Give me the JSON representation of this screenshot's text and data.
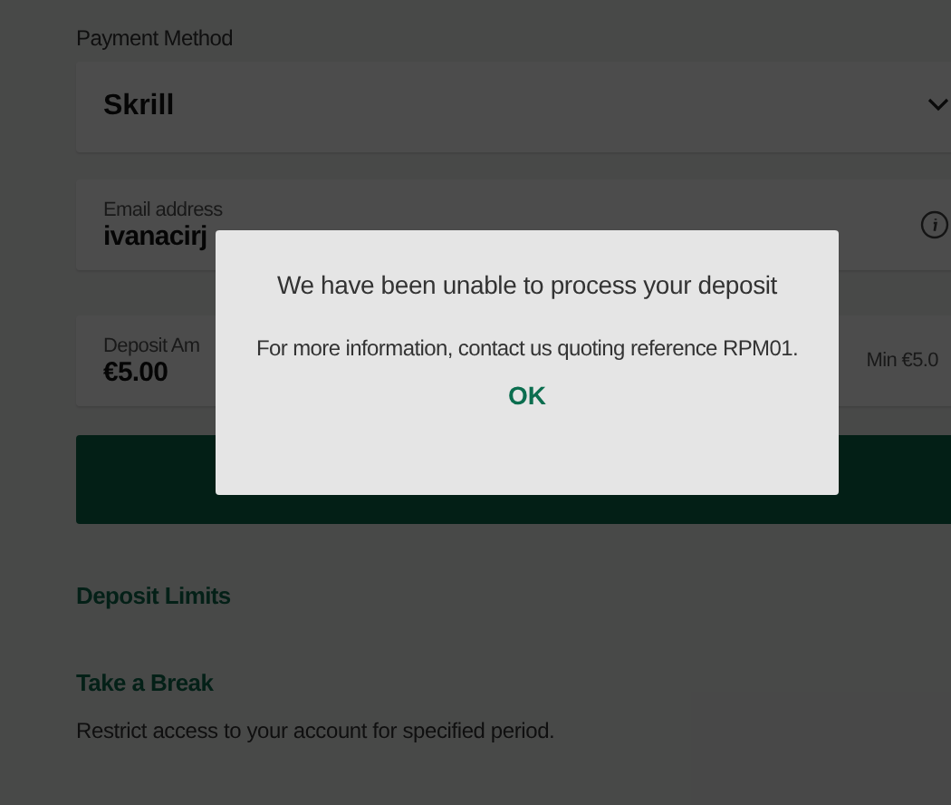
{
  "payment_method": {
    "label": "Payment Method",
    "value": "Skrill"
  },
  "email": {
    "label": "Email address",
    "value": "ivanacirj"
  },
  "deposit_amount": {
    "label": "Deposit Am",
    "value": "€5.00",
    "hint": "Min €5.0"
  },
  "links": [
    {
      "kind": "heading",
      "text": "Deposit Limits"
    },
    {
      "kind": "heading",
      "text": "Take a Break"
    },
    {
      "kind": "description",
      "text": "Restrict access to your account for specified period."
    }
  ],
  "dialog": {
    "title": "We have been unable to process your deposit",
    "message": "For more information, contact us quoting reference RPM01.",
    "button": "OK"
  }
}
